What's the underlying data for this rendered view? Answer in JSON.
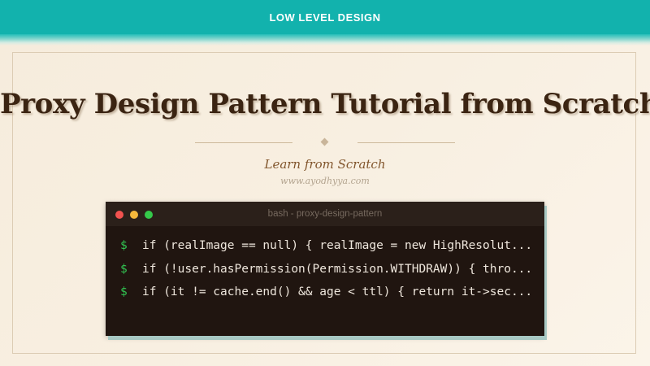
{
  "header": {
    "label": "LOW LEVEL DESIGN"
  },
  "hero": {
    "title": "Proxy Design Pattern Tutorial from Scratch",
    "subtitle": "Learn from Scratch",
    "site": "www.ayodhyya.com"
  },
  "terminal": {
    "title": "bash - proxy-design-pattern",
    "prompt": "$",
    "lines": [
      "if (realImage == null) { realImage = new HighResolut...",
      "if (!user.hasPermission(Permission.WITHDRAW)) { thro...",
      "if (it != cache.end() && age < ttl) { return it->sec..."
    ]
  },
  "colors": {
    "header_bg": "#12b2ad",
    "title": "#3b2412",
    "subtitle": "#82562d",
    "terminal_bg": "#201510",
    "prompt": "#32c552"
  }
}
